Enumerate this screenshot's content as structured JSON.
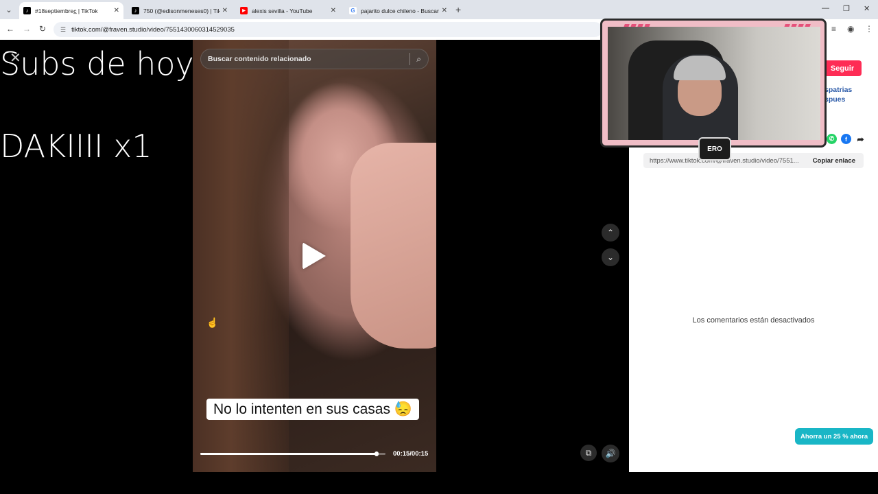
{
  "browser": {
    "tabs": [
      {
        "title": "#18septiembrec̲ | TikTok",
        "active": true,
        "favicon": "tiktok-icon"
      },
      {
        "title": "750 (@edisonmeneses0) | TikTo",
        "active": false,
        "favicon": "tiktok-icon"
      },
      {
        "title": "alexis sevilla - YouTube",
        "active": false,
        "favicon": "youtube-icon"
      },
      {
        "title": "pajarito dulce chileno - Buscar",
        "active": false,
        "favicon": "google-icon"
      }
    ],
    "address": "tiktok.com/@fraven.studio/video/7551430060314529035"
  },
  "overlay": {
    "heading": "Subs de hoy:",
    "sub_line": "DAKIIII x1"
  },
  "video": {
    "search_placeholder": "Buscar contenido relacionado",
    "caption": "No lo intenten en sus casas 😓",
    "time": "00:15/00:15",
    "progress": 0.95
  },
  "panel": {
    "follow_label": "Seguir",
    "peek_line1": "spatrias",
    "peek_line2": "spues",
    "link_url": "https://www.tiktok.com/@fraven.studio/video/7551...",
    "copy_label": "Copiar enlace",
    "comments_disabled": "Los comentarios están desactivados",
    "promo_label": "Ahorra un 25 % ahora"
  },
  "webcam": {
    "logo_text": "ERO"
  },
  "colors": {
    "accent": "#fe2c55",
    "promo": "#19b6c6",
    "link": "#2b5aa8"
  }
}
